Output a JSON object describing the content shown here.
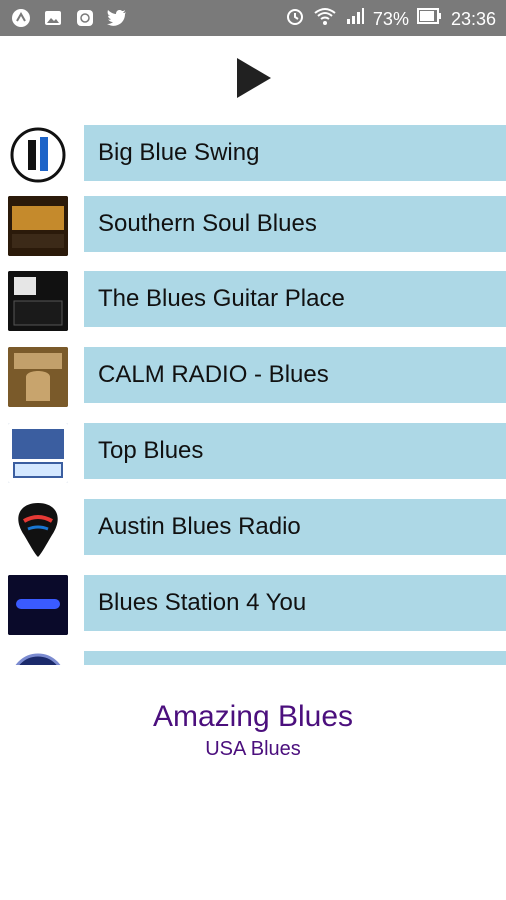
{
  "status_bar": {
    "battery": "73%",
    "time": "23:36",
    "left_icons": [
      "alert-icon",
      "image-icon",
      "app-icon",
      "twitter-icon"
    ],
    "right_icons": [
      "alarm-icon",
      "wifi-icon",
      "signal-icon",
      "battery-icon"
    ]
  },
  "toolbar": {
    "play_icon": "play-icon"
  },
  "stations": [
    {
      "name": "Big Blue Swing",
      "thumb_color": "#ffffff"
    },
    {
      "name": "Southern Soul Blues",
      "thumb_color": "#2b1a0a"
    },
    {
      "name": "The Blues Guitar Place",
      "thumb_color": "#111111"
    },
    {
      "name": "CALM RADIO - Blues",
      "thumb_color": "#7a5a2a"
    },
    {
      "name": "Top Blues",
      "thumb_color": "#5a7fa5"
    },
    {
      "name": "Austin Blues Radio",
      "thumb_color": "#222222"
    },
    {
      "name": "Blues Station 4 You",
      "thumb_color": "#0a0a2a"
    },
    {
      "name": "",
      "thumb_color": "#1b2a6b"
    }
  ],
  "now_playing": {
    "title": "Amazing Blues",
    "subtitle": "USA Blues"
  }
}
